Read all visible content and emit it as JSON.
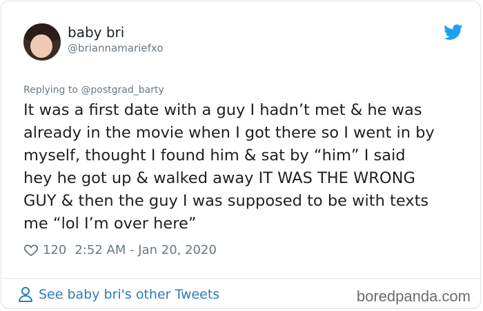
{
  "user": {
    "display_name": "baby bri",
    "handle": "@briannamariefxo"
  },
  "reply": {
    "prefix": "Replying to ",
    "to_handle": "@postgrad_barty"
  },
  "tweet": {
    "text": "It was a first date with a guy I hadn’t met & he was\nalready in the movie when I got there so I went in by\nmyself, thought I found him & sat by “him” I said\nhey he got up & walked away IT WAS THE WRONG\nGUY & then the guy I was supposed to be with texts\nme “lol I’m over here”",
    "likes": "120",
    "timestamp": "2:52 AM - Jan 20, 2020"
  },
  "footer": {
    "see_more": "See baby bri's other Tweets",
    "watermark": "boredpanda.com"
  },
  "icons": {
    "brand": "twitter-bird-icon",
    "like": "heart-icon",
    "profile": "person-icon"
  },
  "colors": {
    "twitter_blue": "#1da1f2",
    "link": "#2b7bb9",
    "muted": "#697882",
    "text": "#1c2022"
  }
}
